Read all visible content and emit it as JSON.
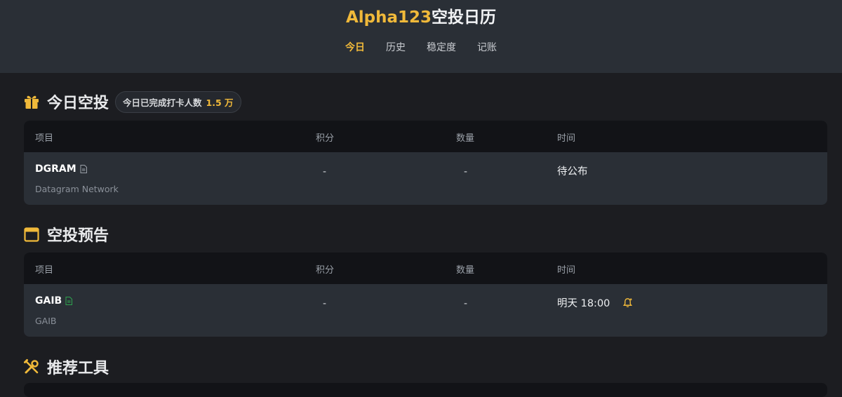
{
  "header": {
    "title_accent": "Alpha123",
    "title_rest": "空投日历",
    "tabs": [
      "今日",
      "历史",
      "稳定度",
      "记账"
    ],
    "active_tab": "今日"
  },
  "today": {
    "icon": "gift-icon",
    "title": "今日空投",
    "pill_label": "今日已完成打卡人数",
    "pill_value": "1.5 万",
    "columns": [
      "项目",
      "积分",
      "数量",
      "时间"
    ],
    "rows": [
      {
        "symbol": "DGRAM",
        "name": "Datagram Network",
        "points": "-",
        "amount": "-",
        "time": "待公布",
        "doc_icon_color": "#9aa0a8"
      }
    ]
  },
  "upcoming": {
    "icon": "calendar-icon",
    "title": "空投预告",
    "columns": [
      "项目",
      "积分",
      "数量",
      "时间"
    ],
    "rows": [
      {
        "symbol": "GAIB",
        "name": "GAIB",
        "points": "-",
        "amount": "-",
        "time": "明天 18:00",
        "doc_icon_color": "#2ea44f",
        "bell_icon": "bell-icon"
      }
    ]
  },
  "tools": {
    "icon": "tools-icon",
    "title": "推荐工具"
  },
  "colors": {
    "accent": "#f0b93a",
    "bg": "#1c1d21",
    "card": "#2a2f36",
    "thead": "#121317"
  }
}
